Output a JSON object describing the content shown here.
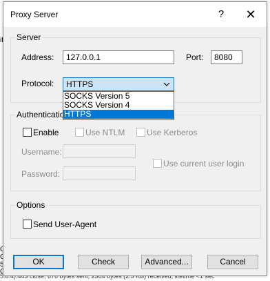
{
  "dialog": {
    "title": "Proxy Server",
    "help_glyph": "?",
    "close_glyph": "✕"
  },
  "server": {
    "legend": "Server",
    "address_label": "Address:",
    "address_value": "127.0.0.1",
    "port_label": "Port:",
    "port_value": "8080",
    "protocol_label": "Protocol:",
    "protocol_value": "HTTPS",
    "protocol_options": [
      "SOCKS Version 5",
      "SOCKS Version 4",
      "HTTPS"
    ]
  },
  "authentication": {
    "legend": "Authenticatio",
    "enable_label": "Enable",
    "use_ntlm_label": "Use NTLM",
    "use_kerberos_label": "Use Kerberos",
    "username_label": "Username:",
    "password_label": "Password:",
    "use_current_login_label": "Use current user login"
  },
  "options": {
    "legend": "Options",
    "send_user_agent_label": "Send User-Agent"
  },
  "buttons": {
    "ok": "OK",
    "check": "Check",
    "advanced": "Advanced...",
    "cancel": "Cancel"
  },
  "backdrop": {
    "left_fragments": [
      "if",
      "C",
      "C",
      "5.",
      "C"
    ],
    "bottom_text": "5.8.4):443 close, 676 bytes sent, 2364 bytes (2.3 KB) received, lifetime <1 sec"
  },
  "colors": {
    "accent": "#0078d7",
    "dialog_bg": "#f0f0f0",
    "disabled_text": "#8c8c8c"
  }
}
